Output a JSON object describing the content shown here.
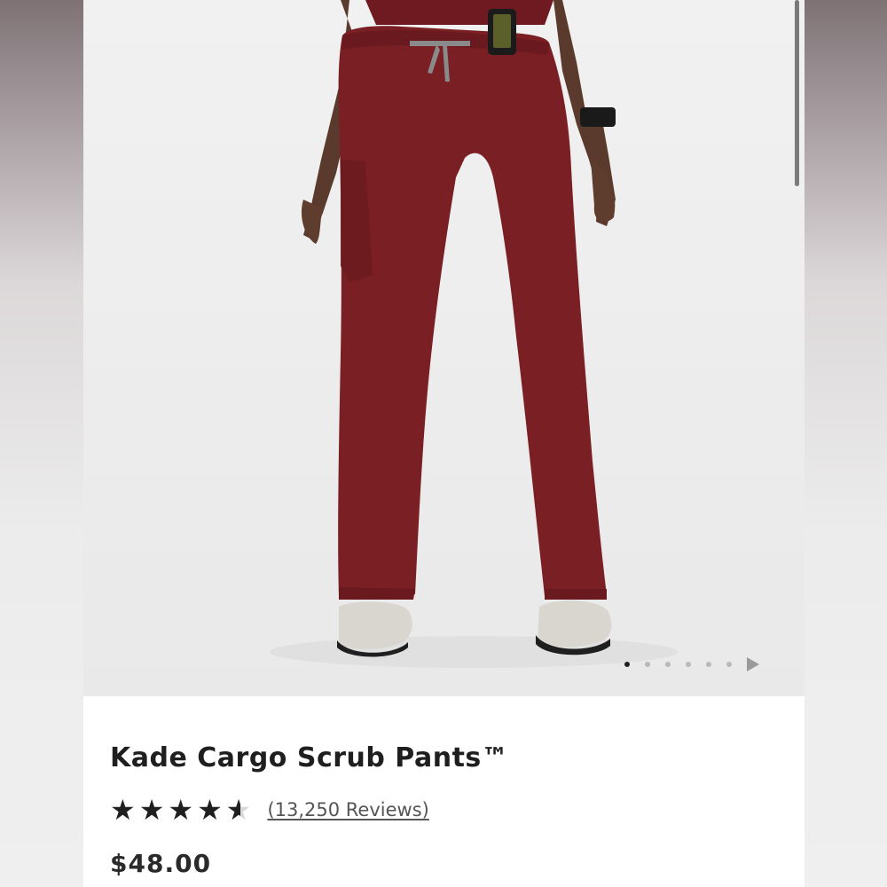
{
  "product": {
    "title": "Kade Cargo Scrub Pants™",
    "rating": 4.5,
    "rating_max": 5,
    "reviews_label": "(13,250 Reviews)",
    "price": "$48.00",
    "image_alt": "Model wearing burgundy cargo scrub pants"
  },
  "gallery": {
    "total_images": 6,
    "active_index": 0,
    "next_icon": "play-triangle-icon"
  },
  "colors": {
    "pants": "#7a1f24",
    "accent_text": "#1f1f1f",
    "drawstring": "#8a8a8a"
  }
}
